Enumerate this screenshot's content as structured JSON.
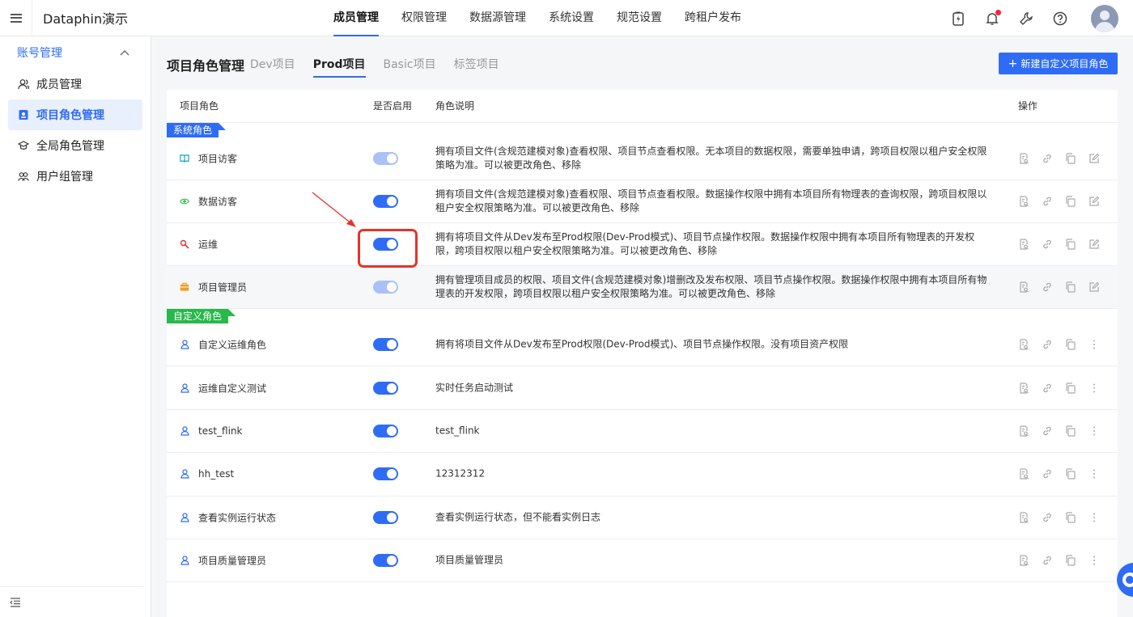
{
  "app": {
    "title": "Dataphin演示"
  },
  "topnav": [
    {
      "label": "成员管理",
      "active": true
    },
    {
      "label": "权限管理",
      "active": false
    },
    {
      "label": "数据源管理",
      "active": false
    },
    {
      "label": "系统设置",
      "active": false
    },
    {
      "label": "规范设置",
      "active": false
    },
    {
      "label": "跨租户发布",
      "active": false
    }
  ],
  "sidebar": {
    "group_label": "账号管理",
    "items": [
      {
        "label": "成员管理",
        "icon": "users-icon",
        "active": false
      },
      {
        "label": "项目角色管理",
        "icon": "id-card-icon",
        "active": true
      },
      {
        "label": "全局角色管理",
        "icon": "graduation-cap-icon",
        "active": false
      },
      {
        "label": "用户组管理",
        "icon": "user-group-icon",
        "active": false
      }
    ]
  },
  "panel": {
    "title": "项目角色管理",
    "tabs": [
      {
        "label": "Dev项目",
        "active": false
      },
      {
        "label": "Prod项目",
        "active": true
      },
      {
        "label": "Basic项目",
        "active": false
      },
      {
        "label": "标签项目",
        "active": false
      }
    ],
    "new_button": "新建自定义项目角色",
    "columns": {
      "role": "项目角色",
      "enabled": "是否启用",
      "description": "角色说明",
      "actions": "操作"
    },
    "system_tag": "系统角色",
    "custom_tag": "自定义角色",
    "system_roles": [
      {
        "name": "项目访客",
        "icon": "book-icon",
        "icon_color": "#1aa3c6",
        "enabled": true,
        "disabled": true,
        "description": "拥有项目文件(含规范建模对象)查看权限、项目节点查看权限。无本项目的数据权限，需要单独申请，跨项目权限以租户安全权限策略为准。可以被更改角色、移除"
      },
      {
        "name": "数据访客",
        "icon": "eye-icon",
        "icon_color": "#28b84b",
        "enabled": true,
        "disabled": false,
        "description": "拥有项目文件(含规范建模对象)查看权限、项目节点查看权限。数据操作权限中拥有本项目所有物理表的查询权限，跨项目权限以租户安全权限策略为准。可以被更改角色、移除"
      },
      {
        "name": "运维",
        "icon": "wrench-icon",
        "icon_color": "#e5332a",
        "enabled": true,
        "disabled": false,
        "description": "拥有将项目文件从Dev发布至Prod权限(Dev-Prod模式)、项目节点操作权限。数据操作权限中拥有本项目所有物理表的开发权限，跨项目权限以租户安全权限策略为准。可以被更改角色、移除"
      },
      {
        "name": "项目管理员",
        "icon": "briefcase-icon",
        "icon_color": "#f0a023",
        "enabled": true,
        "disabled": true,
        "description": "拥有管理项目成员的权限、项目文件(含规范建模对象)增删改及发布权限、项目节点操作权限。数据操作权限中拥有本项目所有物理表的开发权限，跨项目权限以租户安全权限策略为准。可以被更改角色、移除"
      }
    ],
    "custom_roles": [
      {
        "name": "自定义运维角色",
        "enabled": true,
        "description": "拥有将项目文件从Dev发布至Prod权限(Dev-Prod模式)、项目节点操作权限。没有项目资产权限"
      },
      {
        "name": "运维自定义测试",
        "enabled": true,
        "description": "实时任务启动测试"
      },
      {
        "name": "test_flink",
        "enabled": true,
        "description": "test_flink"
      },
      {
        "name": "hh_test",
        "enabled": true,
        "description": "12312312"
      },
      {
        "name": "查看实例运行状态",
        "enabled": true,
        "description": "查看实例运行状态，但不能看实例日志"
      },
      {
        "name": "项目质量管理员",
        "enabled": true,
        "description": "项目质量管理员"
      }
    ]
  },
  "colors": {
    "accent": "#2f6cf6",
    "highlight": "#e5332a",
    "custom_tag": "#28b84b"
  }
}
